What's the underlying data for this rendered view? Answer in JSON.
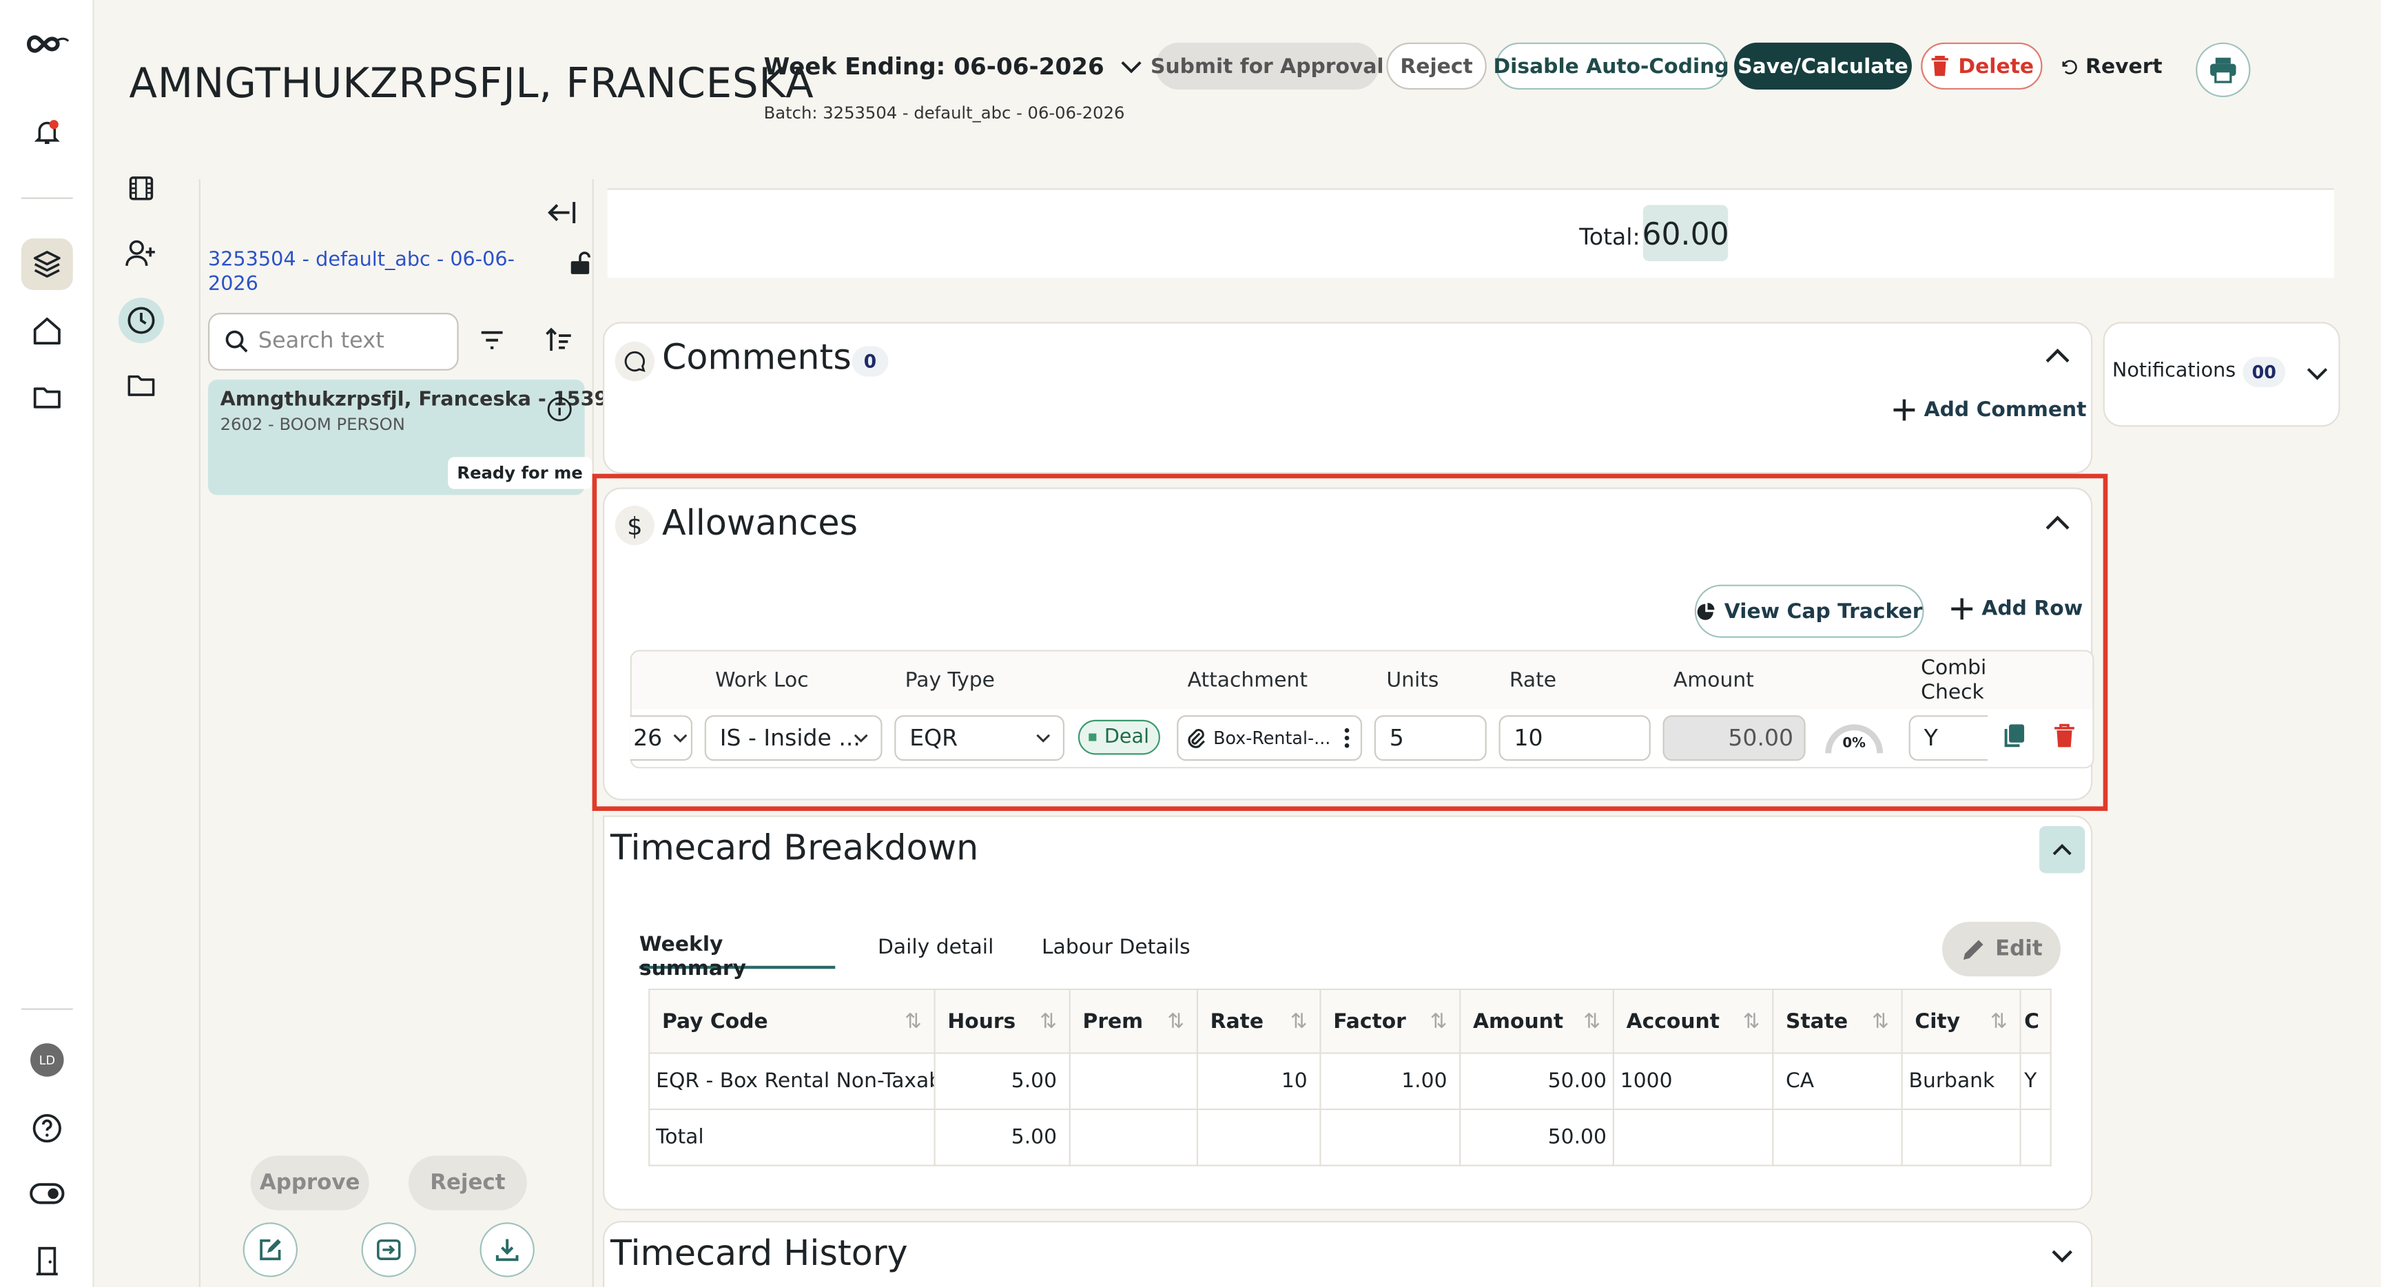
{
  "header": {
    "employee_name": "AMNGTHUKZRPSFJL, FRANCESKA",
    "week_ending": "Week Ending: 06-06-2026",
    "batch": "Batch: 3253504 - default_abc - 06-06-2026",
    "buttons": {
      "submit": "Submit for Approval",
      "reject": "Reject",
      "disable_auto": "Disable Auto-Coding",
      "save": "Save/Calculate",
      "delete": "Delete",
      "revert": "Revert"
    }
  },
  "rail": {
    "avatar_initials": "LD"
  },
  "sidepanel": {
    "batch_link": "3253504 - default_abc - 06-06-2026",
    "search_placeholder": "Search text",
    "card": {
      "name": "Amngthukzrpsfjl, Franceska - 1539",
      "sub": "2602 - BOOM PERSON",
      "status": "Ready for me"
    },
    "approve": "Approve",
    "reject": "Reject"
  },
  "totals": {
    "label": "Total:",
    "value": "60.00"
  },
  "comments": {
    "title": "Comments",
    "count": "0",
    "add": "Add Comment"
  },
  "notifications": {
    "label": "Notifications",
    "count": "00"
  },
  "allowances": {
    "title": "Allowances",
    "view_cap": "View Cap Tracker",
    "add_row": "Add Row",
    "headers": {
      "work_loc": "Work Loc",
      "pay_type": "Pay Type",
      "attachment": "Attachment",
      "units": "Units",
      "rate": "Rate",
      "amount": "Amount",
      "combi": "Combi",
      "check": "Check"
    },
    "row": {
      "date_partial": "26",
      "work_loc": "IS - Inside ...",
      "pay_type": "EQR",
      "deal": "Deal",
      "attachment": "Box-Rental-...",
      "units": "5",
      "rate": "10",
      "amount": "50.00",
      "cap_pct": "0%",
      "combi": "Y"
    }
  },
  "breakdown": {
    "title": "Timecard Breakdown",
    "tabs": [
      "Weekly summary",
      "Daily detail",
      "Labour Details"
    ],
    "edit": "Edit",
    "columns": [
      "Pay Code",
      "Hours",
      "Prem",
      "Rate",
      "Factor",
      "Amount",
      "Account",
      "State",
      "City",
      "C"
    ],
    "rows": [
      [
        "EQR - Box Rental Non-Taxable",
        "5.00",
        "",
        "10",
        "1.00",
        "50.00",
        "1000",
        "CA",
        "Burbank",
        "Y"
      ],
      [
        "Total",
        "5.00",
        "",
        "",
        "",
        "50.00",
        "",
        "",
        "",
        ""
      ]
    ]
  },
  "history": {
    "title": "Timecard History"
  }
}
